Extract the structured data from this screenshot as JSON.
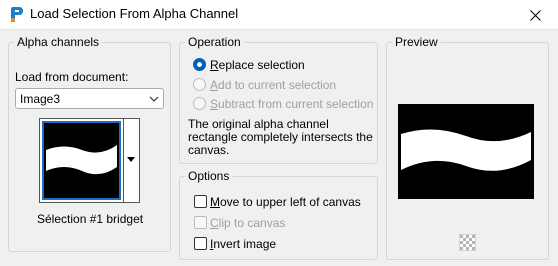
{
  "window": {
    "title": "Load Selection From Alpha Channel",
    "app_icon": "paintshop-icon",
    "close_icon": "close-icon"
  },
  "alpha_channels": {
    "group_label": "Alpha channels",
    "load_from_label": "Load from document:",
    "document_value": "Image3",
    "channel_name": "Sélection #1 bridget"
  },
  "operation": {
    "group_label": "Operation",
    "options": [
      {
        "label": "Replace selection",
        "selected": true,
        "enabled": true
      },
      {
        "label": "Add to current selection",
        "selected": false,
        "enabled": false
      },
      {
        "label": "Subtract from current selection",
        "selected": false,
        "enabled": false
      }
    ],
    "message": [
      "The original alpha channel",
      "rectangle completely intersects the",
      "canvas."
    ]
  },
  "options": {
    "group_label": "Options",
    "items": [
      {
        "label": "Move to upper left of canvas",
        "checked": false,
        "enabled": true
      },
      {
        "label": "Clip to canvas",
        "checked": false,
        "enabled": false
      },
      {
        "label": "Invert image",
        "checked": false,
        "enabled": true
      }
    ]
  },
  "preview": {
    "group_label": "Preview",
    "background_icon": "checkerboard-icon"
  },
  "colors": {
    "accent": "#005fb8",
    "selection_border": "#1f6cc4",
    "disabled_text": "#a0a0a0"
  }
}
